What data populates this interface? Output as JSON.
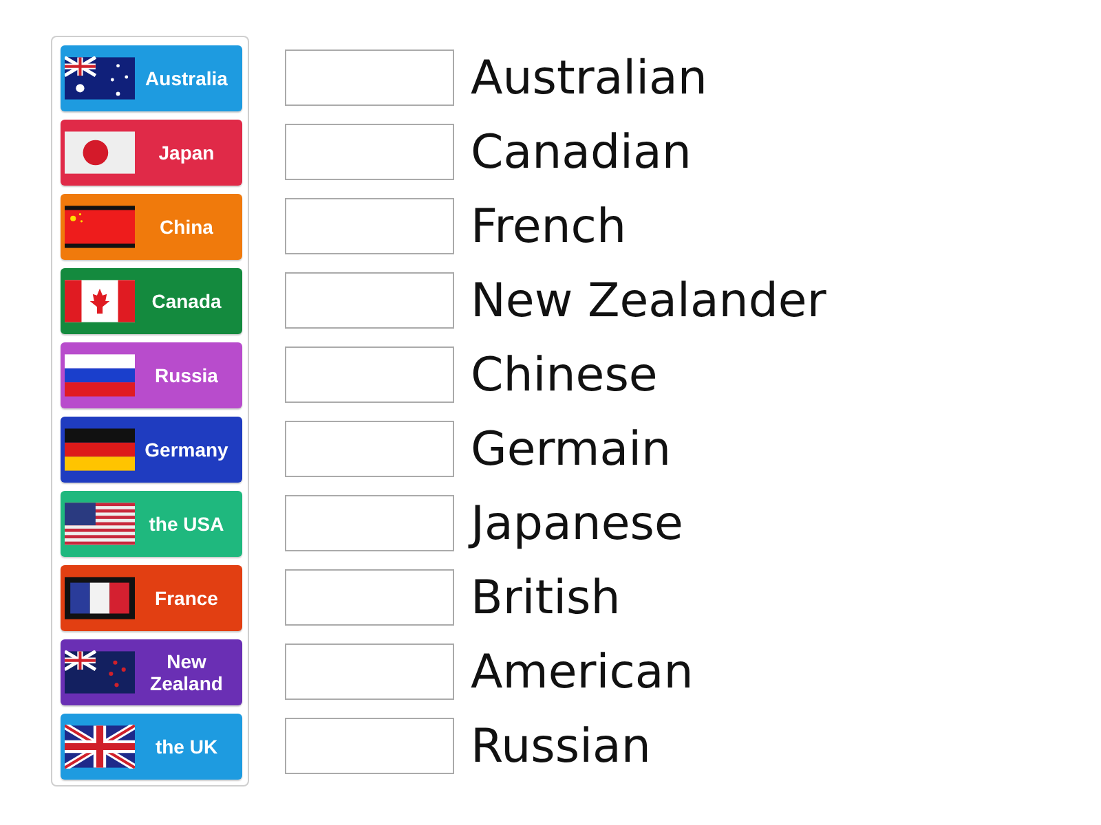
{
  "tiles": [
    {
      "label": "Australia",
      "color": "#1e9be0"
    },
    {
      "label": "Japan",
      "color": "#e02a48"
    },
    {
      "label": "China",
      "color": "#f07a0c"
    },
    {
      "label": "Canada",
      "color": "#148a3e"
    },
    {
      "label": "Russia",
      "color": "#b84ccc"
    },
    {
      "label": "Germany",
      "color": "#1f3cc0"
    },
    {
      "label": "the USA",
      "color": "#1fb87e"
    },
    {
      "label": "France",
      "color": "#e23f12"
    },
    {
      "label": "New Zealand",
      "color": "#6a2fb4"
    },
    {
      "label": "the UK",
      "color": "#1e9be0"
    }
  ],
  "answers": [
    {
      "word": "Australian"
    },
    {
      "word": "Canadian"
    },
    {
      "word": "French"
    },
    {
      "word": "New Zealander"
    },
    {
      "word": "Chinese"
    },
    {
      "word": "Germain"
    },
    {
      "word": "Japanese"
    },
    {
      "word": "British"
    },
    {
      "word": "American"
    },
    {
      "word": "Russian"
    }
  ]
}
